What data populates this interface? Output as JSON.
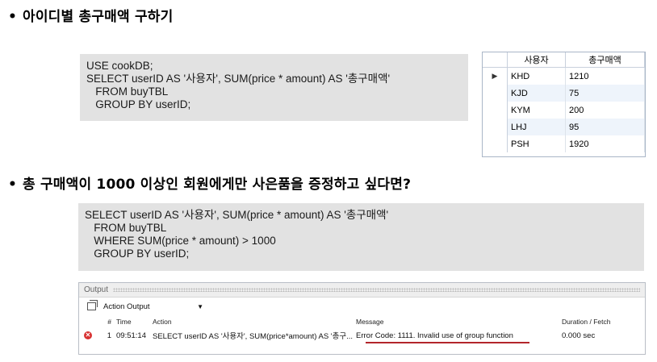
{
  "section1": {
    "bullet": "•",
    "title": "아이디별 총구매액 구하기",
    "code_lines": [
      "USE cookDB;",
      "SELECT userID AS '사용자', SUM(price * amount) AS '총구매액'",
      "   FROM buyTBL",
      "   GROUP BY userID;"
    ]
  },
  "result_grid": {
    "selected_row_marker": "▶",
    "columns": [
      "사용자",
      "총구매액"
    ],
    "rows": [
      [
        "KHD",
        "1210"
      ],
      [
        "KJD",
        "75"
      ],
      [
        "KYM",
        "200"
      ],
      [
        "LHJ",
        "95"
      ],
      [
        "PSH",
        "1920"
      ]
    ]
  },
  "section2": {
    "bullet": "•",
    "title": "총 구매액이 1000 이상인 회원에게만 사은품을 증정하고 싶다면?",
    "code_lines": [
      "SELECT userID AS '사용자', SUM(price * amount) AS '총구매액'",
      "   FROM buyTBL",
      "   WHERE SUM(price * amount) > 1000",
      "   GROUP BY userID;"
    ]
  },
  "output_panel": {
    "title": "Output",
    "dropdown_value": "Action Output",
    "columns": {
      "num": "#",
      "time": "Time",
      "action": "Action",
      "message": "Message",
      "duration": "Duration / Fetch"
    },
    "row": {
      "num": "1",
      "time": "09:51:14",
      "action": "SELECT userID AS '사용자', SUM(price*amount) AS '총구...",
      "message": "Error Code: 1111. Invalid use of group function",
      "duration": "0.000 sec",
      "status_icon": "error-icon"
    },
    "error_underline_color": "#b3262b"
  }
}
